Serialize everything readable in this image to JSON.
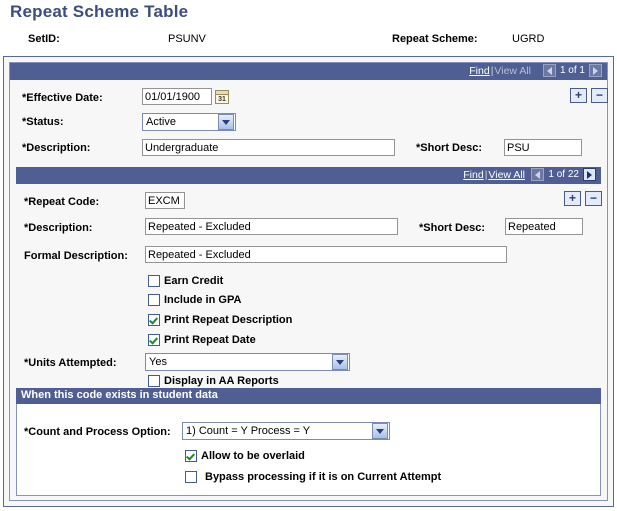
{
  "page": {
    "title": "Repeat Scheme Table"
  },
  "key_fields": {
    "setid_label": "SetID:",
    "setid_value": "PSUNV",
    "scheme_label": "Repeat Scheme:",
    "scheme_value": "UGRD"
  },
  "navbar_effdt": {
    "find_label": "Find",
    "separator": "|",
    "view_all_label": "View All",
    "counter": "1 of 1",
    "prev_enabled": false,
    "next_enabled": false,
    "find_enabled": true,
    "view_all_enabled": false
  },
  "navbar_repeatcode": {
    "find_label": "Find",
    "separator": "|",
    "view_all_label": "View All",
    "counter": "1 of 22",
    "prev_enabled": false,
    "next_enabled": true,
    "find_enabled": true,
    "view_all_enabled": true
  },
  "row_buttons": {
    "add_label": "+",
    "delete_label": "−"
  },
  "effective_dated_section": {
    "effective_date_label": "*Effective Date:",
    "effective_date_value": "01/01/1900",
    "calendar_icon_text": "31",
    "status_label": "*Status:",
    "status_value": "Active",
    "description_label": "*Description:",
    "description_value": "Undergraduate",
    "short_desc_label": "*Short Desc:",
    "short_desc_value": "PSU"
  },
  "repeat_code_section": {
    "repeat_code_label": "*Repeat Code:",
    "repeat_code_value": "EXCM",
    "description_label": "*Description:",
    "description_value": "Repeated - Excluded",
    "short_desc_label": "*Short Desc:",
    "short_desc_value": "Repeated",
    "formal_description_label": "Formal Description:",
    "formal_description_value": "Repeated - Excluded",
    "checkboxes": [
      {
        "label": "Earn Credit",
        "checked": false
      },
      {
        "label": "Include in GPA",
        "checked": false
      },
      {
        "label": "Print Repeat Description",
        "checked": true
      },
      {
        "label": "Print Repeat Date",
        "checked": true
      }
    ],
    "units_attempted_label": "*Units Attempted:",
    "units_attempted_value": "Yes",
    "display_aa_label": "Display in AA Reports",
    "display_aa_checked": false
  },
  "student_data_group": {
    "header": "When this code exists in student data",
    "count_process_label": "*Count and Process Option:",
    "count_process_value": "1) Count = Y  Process = Y",
    "allow_overlaid_label": "Allow to be overlaid",
    "allow_overlaid_checked": true,
    "bypass_label": "Bypass processing if it is on Current Attempt",
    "bypass_checked": false
  },
  "colors": {
    "title": "#3b4e7e",
    "navbar": "#4f5f93",
    "frame": "#5a6a97",
    "check": "#1a8a2e",
    "button_border": "#4a5b8e"
  }
}
